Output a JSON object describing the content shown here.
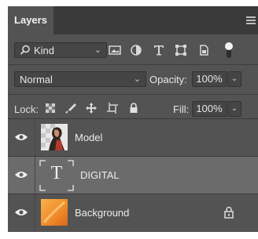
{
  "panel": {
    "tab_label": "Layers",
    "menu_icon": "hamburger-menu-icon"
  },
  "filter": {
    "kind_label": "Kind",
    "icons": [
      "image-filter-icon",
      "adjustment-filter-icon",
      "type-filter-icon",
      "shape-filter-icon",
      "smart-object-filter-icon",
      "filter-toggle-icon"
    ]
  },
  "blend": {
    "mode": "Normal",
    "opacity_label": "Opacity:",
    "opacity_value": "100%"
  },
  "lock": {
    "label": "Lock:",
    "fill_label": "Fill:",
    "fill_value": "100%",
    "icons": [
      "lock-transparent-pixels-icon",
      "lock-image-pixels-icon",
      "lock-position-icon",
      "lock-artboard-icon",
      "lock-all-icon"
    ]
  },
  "layers": [
    {
      "name": "Model",
      "type": "image",
      "selected": false,
      "locked": false
    },
    {
      "name": "DIGITAL",
      "type": "text",
      "thumb_glyph": "T",
      "selected": true,
      "locked": false
    },
    {
      "name": "Background",
      "type": "image",
      "selected": false,
      "locked": true
    }
  ],
  "colors": {
    "panel_bg": "#535353",
    "selected_row": "#6b6b6b",
    "tab_bar": "#3a3a3a"
  }
}
